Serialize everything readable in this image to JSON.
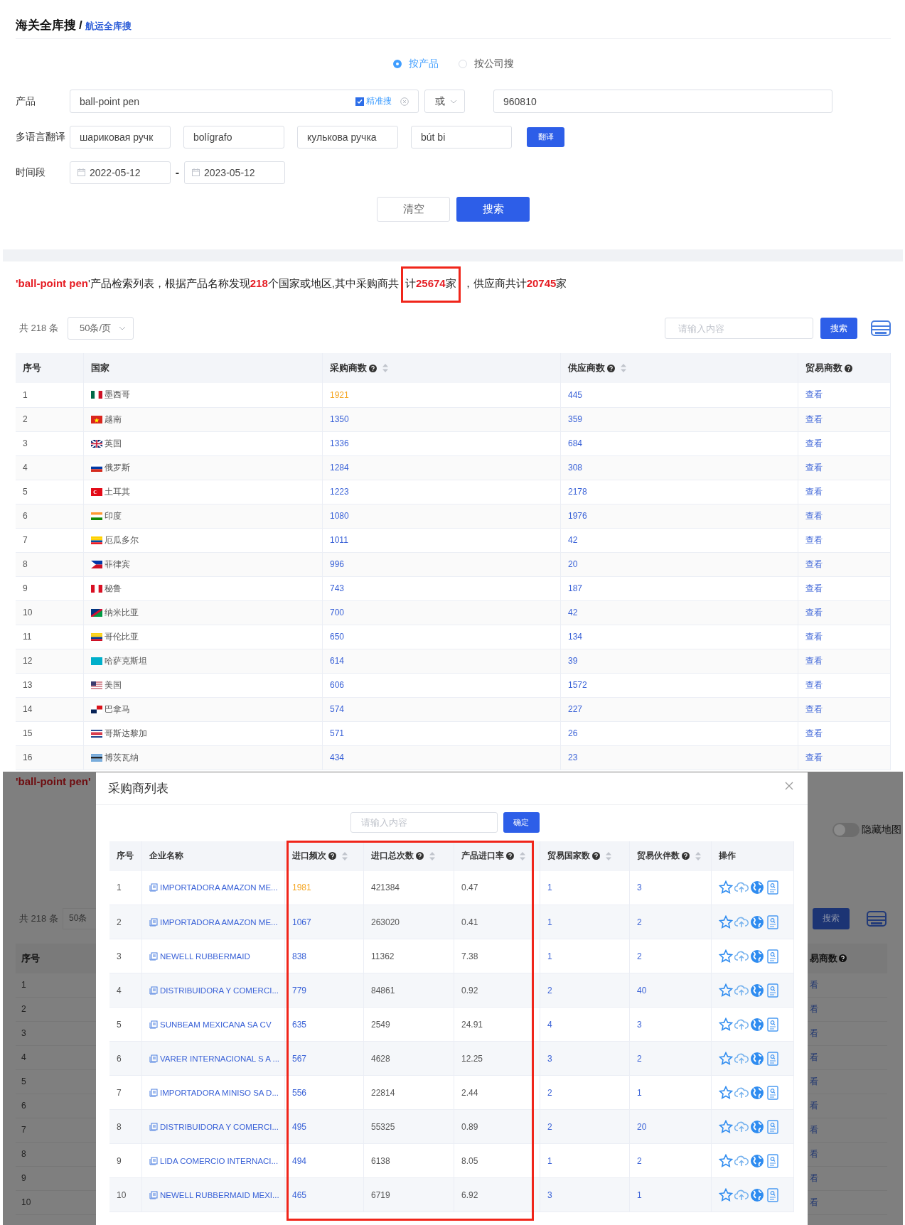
{
  "breadcrumb": {
    "root": "海关全库搜",
    "separator": "/",
    "current": "航运全库搜"
  },
  "search_modes": [
    {
      "label": "按产品",
      "selected": true
    },
    {
      "label": "按公司搜",
      "selected": false
    }
  ],
  "product": {
    "label": "产品",
    "value": "ball-point pen",
    "exact": {
      "label": "精准搜",
      "checked": true
    },
    "operator": "或",
    "hs_code": "960810"
  },
  "translation": {
    "label": "多语言翻译",
    "values": [
      "шариковая ручк",
      "bolígrafo",
      "кулькова ручка",
      "bút bi"
    ],
    "button": "翻译"
  },
  "period": {
    "label": "时间段",
    "from": "2022-05-12",
    "separator": "-",
    "to": "2023-05-12"
  },
  "actions": [
    {
      "label": "清空",
      "kind": "secondary"
    },
    {
      "label": "搜索",
      "kind": "primary"
    }
  ],
  "summary": "**'ball-point pen**'产品检索列表，根据产品名称发现**218**个国家或地区,其中采购商共计**25674**家，供应商共计**20745**家",
  "toolbar": {
    "total": "共 218 条",
    "page_size": "50条/页",
    "search_placeholder": "请输入内容",
    "search_button": "搜索"
  },
  "countries_table": {
    "columns": [
      {
        "label": "序号",
        "help": false,
        "sortable": false
      },
      {
        "label": "国家",
        "help": false,
        "sortable": false
      },
      {
        "label": "采购商数",
        "help": true,
        "sortable": true
      },
      {
        "label": "供应商数",
        "help": true,
        "sortable": true
      },
      {
        "label": "贸易商数",
        "help": true,
        "sortable": false
      }
    ],
    "rows": [
      {
        "index": "1",
        "country": "墨西哥",
        "buyers": "1921",
        "highlighted": true,
        "suppliers": "445",
        "traders": "查看"
      },
      {
        "index": "2",
        "country": "越南",
        "buyers": "1350",
        "highlighted": false,
        "suppliers": "359",
        "traders": "查看"
      },
      {
        "index": "3",
        "country": "英国",
        "buyers": "1336",
        "highlighted": false,
        "suppliers": "684",
        "traders": "查看"
      },
      {
        "index": "4",
        "country": "俄罗斯",
        "buyers": "1284",
        "highlighted": false,
        "suppliers": "308",
        "traders": "查看"
      },
      {
        "index": "5",
        "country": "土耳其",
        "buyers": "1223",
        "highlighted": false,
        "suppliers": "2178",
        "traders": "查看"
      },
      {
        "index": "6",
        "country": "印度",
        "buyers": "1080",
        "highlighted": false,
        "suppliers": "1976",
        "traders": "查看"
      },
      {
        "index": "7",
        "country": "厄瓜多尔",
        "buyers": "1011",
        "highlighted": false,
        "suppliers": "42",
        "traders": "查看"
      },
      {
        "index": "8",
        "country": "菲律宾",
        "buyers": "996",
        "highlighted": false,
        "suppliers": "20",
        "traders": "查看"
      },
      {
        "index": "9",
        "country": "秘鲁",
        "buyers": "743",
        "highlighted": false,
        "suppliers": "187",
        "traders": "查看"
      },
      {
        "index": "10",
        "country": "纳米比亚",
        "buyers": "700",
        "highlighted": false,
        "suppliers": "42",
        "traders": "查看"
      },
      {
        "index": "11",
        "country": "哥伦比亚",
        "buyers": "650",
        "highlighted": false,
        "suppliers": "134",
        "traders": "查看"
      },
      {
        "index": "12",
        "country": "哈萨克斯坦",
        "buyers": "614",
        "highlighted": false,
        "suppliers": "39",
        "traders": "查看"
      },
      {
        "index": "13",
        "country": "美国",
        "buyers": "606",
        "highlighted": false,
        "suppliers": "1572",
        "traders": "查看"
      },
      {
        "index": "14",
        "country": "巴拿马",
        "buyers": "574",
        "highlighted": false,
        "suppliers": "227",
        "traders": "查看"
      },
      {
        "index": "15",
        "country": "哥斯达黎加",
        "buyers": "571",
        "highlighted": false,
        "suppliers": "26",
        "traders": "查看"
      },
      {
        "index": "16",
        "country": "博茨瓦纳",
        "buyers": "434",
        "highlighted": false,
        "suppliers": "23",
        "traders": "查看"
      }
    ]
  },
  "backdrop": {
    "summary_fragment": "'ball-point pen'",
    "total": "共 218 条",
    "page_size_fragment": "50条",
    "map_toggle": {
      "label": "隐藏地图",
      "on": false
    },
    "search_button": "搜索",
    "first_column": "序号",
    "last_column_fragment": "易商数",
    "rows": [
      {
        "index": "1",
        "action_fragment": "看"
      },
      {
        "index": "2",
        "action_fragment": "看"
      },
      {
        "index": "3",
        "action_fragment": "看"
      },
      {
        "index": "4",
        "action_fragment": "看"
      },
      {
        "index": "5",
        "action_fragment": "看"
      },
      {
        "index": "6",
        "action_fragment": "看"
      },
      {
        "index": "7",
        "action_fragment": "看"
      },
      {
        "index": "8",
        "action_fragment": "看"
      },
      {
        "index": "9",
        "action_fragment": "看"
      },
      {
        "index": "10",
        "action_fragment": "看"
      }
    ]
  },
  "modal": {
    "title": "采购商列表",
    "search_placeholder": "请输入内容",
    "confirm_button": "确定",
    "columns": [
      {
        "label": "序号",
        "help": false,
        "sortable": false
      },
      {
        "label": "企业名称",
        "help": false,
        "sortable": false
      },
      {
        "label": "进口频次",
        "help": true,
        "sortable": true
      },
      {
        "label": "进口总次数",
        "help": true,
        "sortable": true
      },
      {
        "label": "产品进口率",
        "help": true,
        "sortable": true
      },
      {
        "label": "贸易国家数",
        "help": true,
        "sortable": true
      },
      {
        "label": "贸易伙伴数",
        "help": true,
        "sortable": true
      },
      {
        "label": "操作",
        "help": false,
        "sortable": false
      }
    ],
    "rows": [
      {
        "index": "1",
        "company": "IMPORTADORA AMAZON ME...",
        "frequency": "1981",
        "highlighted": true,
        "total": "421384",
        "rate": "0.47",
        "countries": "1",
        "partners": "3"
      },
      {
        "index": "2",
        "company": "IMPORTADORA AMAZON ME...",
        "frequency": "1067",
        "highlighted": false,
        "total": "263020",
        "rate": "0.41",
        "countries": "1",
        "partners": "2"
      },
      {
        "index": "3",
        "company": "NEWELL RUBBERMAID",
        "frequency": "838",
        "highlighted": false,
        "total": "11362",
        "rate": "7.38",
        "countries": "1",
        "partners": "2"
      },
      {
        "index": "4",
        "company": "DISTRIBUIDORA Y COMERCI...",
        "frequency": "779",
        "highlighted": false,
        "total": "84861",
        "rate": "0.92",
        "countries": "2",
        "partners": "40"
      },
      {
        "index": "5",
        "company": "SUNBEAM MEXICANA SA CV",
        "frequency": "635",
        "highlighted": false,
        "total": "2549",
        "rate": "24.91",
        "countries": "4",
        "partners": "3"
      },
      {
        "index": "6",
        "company": "VARER INTERNACIONAL S A ...",
        "frequency": "567",
        "highlighted": false,
        "total": "4628",
        "rate": "12.25",
        "countries": "3",
        "partners": "2"
      },
      {
        "index": "7",
        "company": "IMPORTADORA MINISO SA D...",
        "frequency": "556",
        "highlighted": false,
        "total": "22814",
        "rate": "2.44",
        "countries": "2",
        "partners": "1"
      },
      {
        "index": "8",
        "company": "DISTRIBUIDORA Y COMERCI...",
        "frequency": "495",
        "highlighted": false,
        "total": "55325",
        "rate": "0.89",
        "countries": "2",
        "partners": "20"
      },
      {
        "index": "9",
        "company": "LIDA COMERCIO INTERNACI...",
        "frequency": "494",
        "highlighted": false,
        "total": "6138",
        "rate": "8.05",
        "countries": "1",
        "partners": "2"
      },
      {
        "index": "10",
        "company": "NEWELL RUBBERMAID MEXI...",
        "frequency": "465",
        "highlighted": false,
        "total": "6719",
        "rate": "6.92",
        "countries": "3",
        "partners": "1"
      }
    ]
  }
}
